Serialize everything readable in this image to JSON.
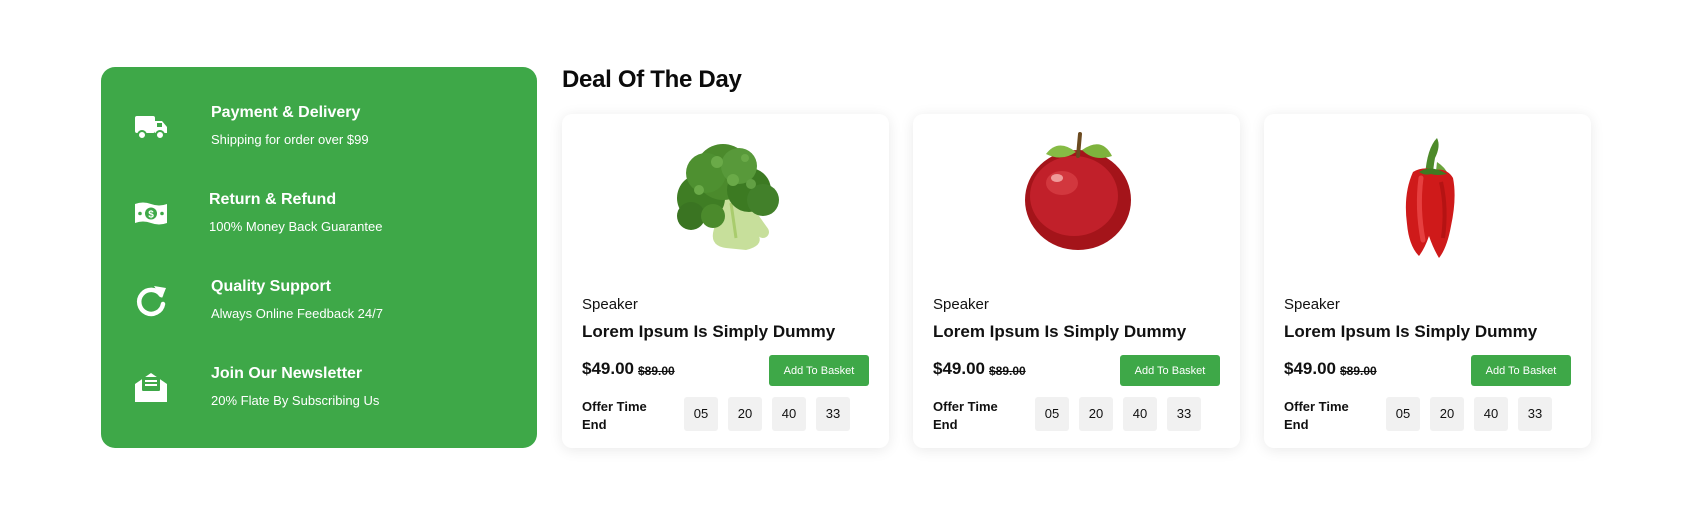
{
  "features": [
    {
      "icon": "truck-icon",
      "title": "Payment & Delivery",
      "subtitle": "Shipping for order over $99"
    },
    {
      "icon": "money-icon",
      "title": "Return & Refund",
      "subtitle": "100% Money Back Guarantee"
    },
    {
      "icon": "refresh-icon",
      "title": "Quality Support",
      "subtitle": "Always Online Feedback 24/7"
    },
    {
      "icon": "envelope-icon",
      "title": "Join Our Newsletter",
      "subtitle": "20% Flate By Subscribing Us"
    }
  ],
  "deal_section": {
    "title": "Deal Of The Day"
  },
  "products": [
    {
      "image": "broccoli-image",
      "category": "Speaker",
      "name": "Lorem Ipsum Is Simply Dummy",
      "price": "$49.00",
      "old_price": "$89.00",
      "button_label": "Add To Basket",
      "offer_label": "Offer Time End",
      "timer": [
        "05",
        "20",
        "40",
        "33"
      ]
    },
    {
      "image": "apple-image",
      "category": "Speaker",
      "name": "Lorem Ipsum Is Simply Dummy",
      "price": "$49.00",
      "old_price": "$89.00",
      "button_label": "Add To Basket",
      "offer_label": "Offer Time End",
      "timer": [
        "05",
        "20",
        "40",
        "33"
      ]
    },
    {
      "image": "red-pepper-image",
      "category": "Speaker",
      "name": "Lorem Ipsum Is Simply Dummy",
      "price": "$49.00",
      "old_price": "$89.00",
      "button_label": "Add To Basket",
      "offer_label": "Offer Time End",
      "timer": [
        "05",
        "20",
        "40",
        "33"
      ]
    }
  ],
  "colors": {
    "accent": "#3ea848",
    "timer_bg": "#f1f1f1",
    "text": "#111111"
  }
}
